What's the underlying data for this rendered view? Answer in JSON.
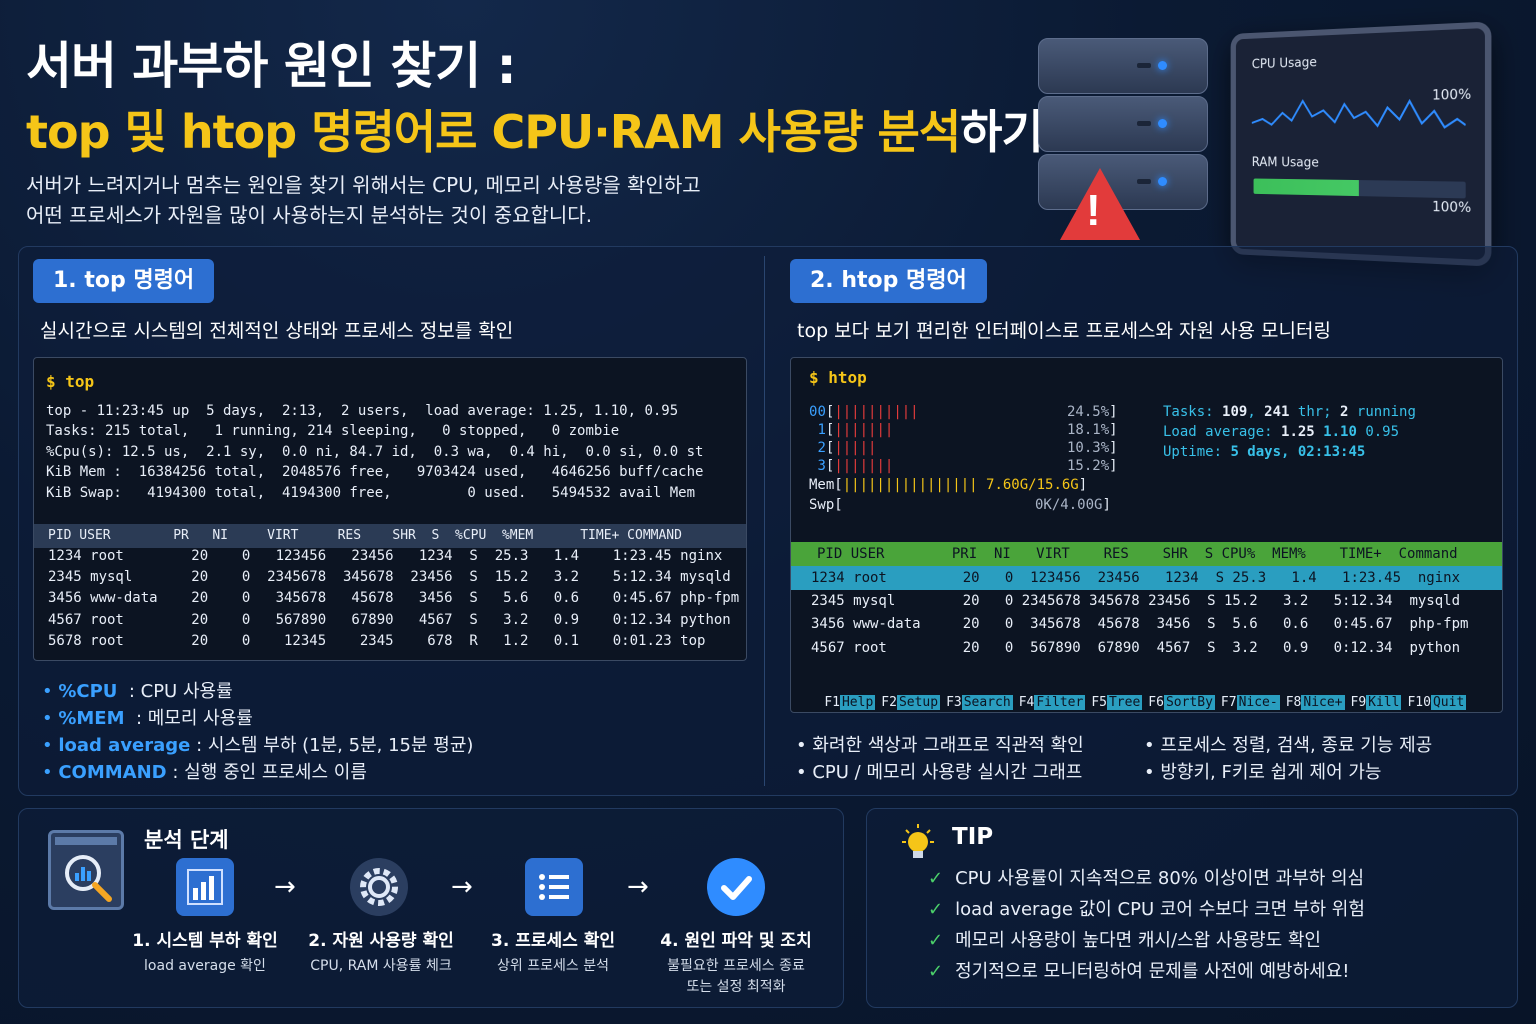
{
  "header": {
    "title_line1": "서버 과부하 원인 찾기 :",
    "title_line2_highlight": "top 및 htop 명령어로 CPU·RAM 사용량 분석",
    "title_line2_rest": "하기",
    "intro_line1": "서버가 느려지거나 멈추는 원인을 찾기 위해서는 CPU, 메모리 사용량을 확인하고",
    "intro_line2": "어떤 프로세스가 자원을 많이 사용하는지 분석하는 것이 중요합니다."
  },
  "monitor": {
    "cpu_label": "CPU Usage",
    "cpu_pct": "100%",
    "ram_label": "RAM Usage",
    "ram_pct": "100%",
    "ram_fill_fraction": 0.52
  },
  "top_section": {
    "badge": "1. top 명령어",
    "desc": "실시간으로 시스템의 전체적인 상태와 프로세스 정보를 확인",
    "prompt": "$ top",
    "summary": [
      "top - 11:23:45 up  5 days,  2:13,  2 users,  load average: 1.25, 1.10, 0.95",
      "Tasks: 215 total,   1 running, 214 sleeping,   0 stopped,   0 zombie",
      "%Cpu(s): 12.5 us,  2.1 sy,  0.0 ni, 84.7 id,  0.3 wa,  0.4 hi,  0.0 si, 0.0 st",
      "KiB Mem :  16384256 total,  2048576 free,   9703424 used,   4646256 buff/cache",
      "KiB Swap:   4194300 total,  4194300 free,         0 used.   5494532 avail Mem"
    ],
    "header": "PID USER        PR   NI     VIRT     RES    SHR  S  %CPU  %MEM      TIME+ COMMAND",
    "rows": [
      "1234 root        20    0   123456   23456   1234  S  25.3   1.4    1:23.45 nginx",
      "2345 mysql       20    0  2345678  345678  23456  S  15.2   3.2    5:12.34 mysqld",
      "3456 www-data    20    0   345678   45678   3456  S   5.6   0.6    0:45.67 php-fpm",
      "4567 root        20    0   567890   67890   4567  S   3.2   0.9    0:12.34 python",
      "5678 root        20    0    12345    2345    678  R   1.2   0.1    0:01.23 top"
    ],
    "bullets": [
      {
        "key": "%CPU",
        "text": "  : CPU 사용률"
      },
      {
        "key": "%MEM",
        "text": "  : 메모리 사용률"
      },
      {
        "key": "load average",
        "text": " : 시스템 부하 (1분, 5분, 15분 평균)"
      },
      {
        "key": "COMMAND",
        "text": " : 실행 중인 프로세스 이름"
      }
    ]
  },
  "htop_section": {
    "badge": "2. htop 명령어",
    "desc": "top 보다 보기 편리한 인터페이스로 프로세스와 자원 사용 모니터링",
    "prompt": "$ htop",
    "cpu_bars": [
      {
        "num": "0",
        "prefix": "0",
        "bars": "||||||||||",
        "pct": "24.5%"
      },
      {
        "num": "1",
        "prefix": " ",
        "bars": "|||||||",
        "pct": "18.1%"
      },
      {
        "num": "2",
        "prefix": " ",
        "bars": "|||||",
        "pct": "10.3%"
      },
      {
        "num": "3",
        "prefix": " ",
        "bars": "|||||||",
        "pct": "15.2%"
      }
    ],
    "mem_label": "Mem[",
    "mem_bars": "||||||||||||||||",
    "mem_value": "7.60G/15.6G",
    "swp_label": "Swp[",
    "swp_value": "0K/4.00G",
    "tasks_label": "Tasks: ",
    "tasks_v1": "109",
    "tasks_sep": ", ",
    "tasks_v2": "241",
    "tasks_thr": " thr; ",
    "tasks_v3": "2",
    "tasks_running": " running",
    "load_label": "Load average: ",
    "load_v1": "1.25",
    "load_v2": "1.10",
    "load_v3": "0.95",
    "uptime_label": "Uptime: ",
    "uptime_value": "5 days, 02:13:45",
    "header": "PID USER        PRI  NI   VIRT    RES    SHR  S CPU%  MEM%    TIME+  Command",
    "selected_row": "1234 root         20   0  123456  23456   1234  S 25.3   1.4   1:23.45  nginx",
    "rows": [
      "2345 mysql        20   0 2345678 345678 23456  S 15.2   3.2   5:12.34  mysqld",
      "3456 www-data     20   0  345678  45678  3456  S  5.6   0.6   0:45.67  php-fpm",
      "4567 root         20   0  567890  67890  4567  S  3.2   0.9   0:12.34  python"
    ],
    "fkeys": [
      {
        "key": "F1",
        "label": "Help"
      },
      {
        "key": "F2",
        "label": "Setup"
      },
      {
        "key": "F3",
        "label": "Search"
      },
      {
        "key": "F4",
        "label": "Filter"
      },
      {
        "key": "F5",
        "label": "Tree"
      },
      {
        "key": "F6",
        "label": "SortBy"
      },
      {
        "key": "F7",
        "label": "Nice-"
      },
      {
        "key": "F8",
        "label": "Nice+"
      },
      {
        "key": "F9",
        "label": "Kill"
      },
      {
        "key": "F10",
        "label": "Quit"
      }
    ],
    "bullets": [
      "화려한 색상과 그래프로 직관적 확인",
      "CPU / 메모리 사용량 실시간 그래프",
      "프로세스 정렬, 검색, 종료 기능 제공",
      "방향키, F키로 쉽게 제어 가능"
    ]
  },
  "analysis": {
    "title": "분석 단계",
    "steps": [
      {
        "title": "1. 시스템 부하 확인",
        "desc": "load average 확인",
        "icon": "bar-chart-icon"
      },
      {
        "title": "2. 자원 사용량 확인",
        "desc": "CPU, RAM 사용률 체크",
        "icon": "gear-icon"
      },
      {
        "title": "3. 프로세스 확인",
        "desc": "상위 프로세스 분석",
        "icon": "list-icon"
      },
      {
        "title": "4. 원인 파악 및 조치",
        "desc": "불필요한 프로세스 종료\n또는 설정 최적화",
        "icon": "check-circle-icon"
      }
    ]
  },
  "tip": {
    "title": "TIP",
    "items": [
      "CPU 사용률이 지속적으로 80% 이상이면 과부하 의심",
      "load average 값이 CPU 코어 수보다 크면 부하 위험",
      "메모리 사용량이 높다면 캐시/스왑 사용량도 확인",
      "정기적으로 모니터링하여 문제를 사전에 예방하세요!"
    ]
  }
}
